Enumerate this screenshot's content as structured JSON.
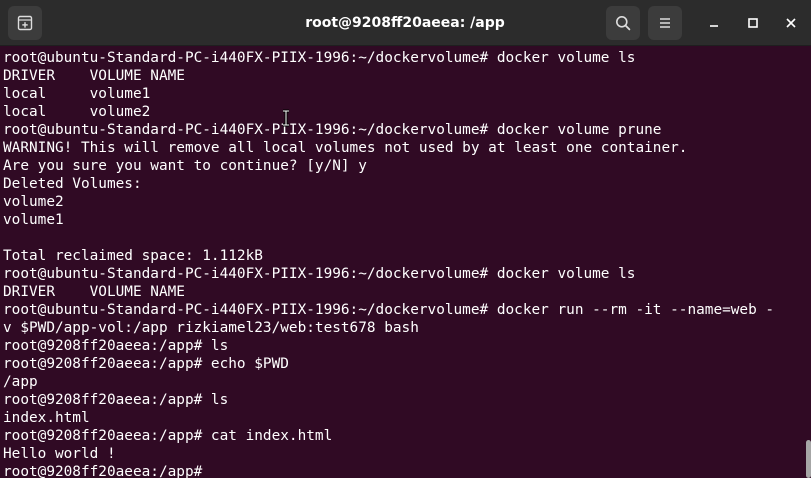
{
  "window": {
    "title": "root@9208ff20aeea: /app"
  },
  "titlebar": {
    "new_tab_icon": "new-tab-icon",
    "search_icon": "search-icon",
    "menu_icon": "hamburger-menu-icon",
    "minimize_icon": "minimize-icon",
    "maximize_icon": "maximize-icon",
    "close_icon": "close-icon"
  },
  "colors": {
    "terminal_bg": "#300a24",
    "titlebar_bg": "#2c2c2c",
    "text": "#ffffff"
  },
  "terminal": {
    "lines": [
      "root@ubuntu-Standard-PC-i440FX-PIIX-1996:~/dockervolume# docker volume ls",
      "DRIVER    VOLUME NAME",
      "local     volume1",
      "local     volume2",
      "root@ubuntu-Standard-PC-i440FX-PIIX-1996:~/dockervolume# docker volume prune",
      "WARNING! This will remove all local volumes not used by at least one container.",
      "Are you sure you want to continue? [y/N] y",
      "Deleted Volumes:",
      "volume2",
      "volume1",
      "",
      "Total reclaimed space: 1.112kB",
      "root@ubuntu-Standard-PC-i440FX-PIIX-1996:~/dockervolume# docker volume ls",
      "DRIVER    VOLUME NAME",
      "root@ubuntu-Standard-PC-i440FX-PIIX-1996:~/dockervolume# docker run --rm -it --name=web -",
      "v $PWD/app-vol:/app rizkiamel23/web:test678 bash",
      "root@9208ff20aeea:/app# ls",
      "root@9208ff20aeea:/app# echo $PWD",
      "/app",
      "root@9208ff20aeea:/app# ls",
      "index.html",
      "root@9208ff20aeea:/app# cat index.html",
      "Hello world !",
      "root@9208ff20aeea:/app#"
    ]
  }
}
